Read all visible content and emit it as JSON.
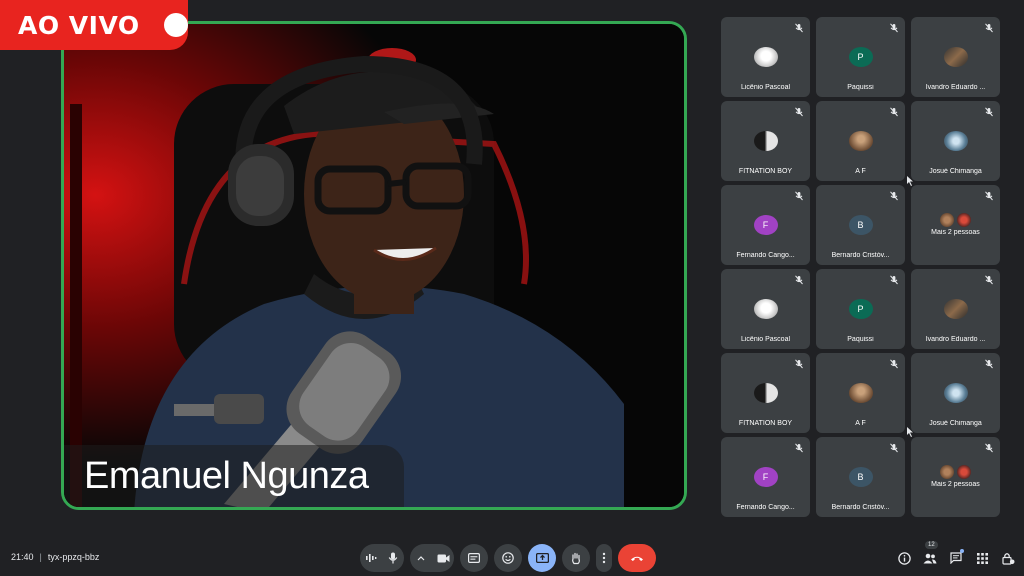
{
  "live_badge": {
    "label": "AO VIVO"
  },
  "main_speaker": {
    "name": "Emanuel Ngunza"
  },
  "participants": [
    {
      "name": "Licênio Pascoal",
      "avatar": "photo-white",
      "initial": ""
    },
    {
      "name": "Paquissi",
      "avatar": "letter-p",
      "initial": "P"
    },
    {
      "name": "Ivandro Eduardo ...",
      "avatar": "photo-dark",
      "initial": ""
    },
    {
      "name": "FITNATION BOY",
      "avatar": "photo-bw",
      "initial": ""
    },
    {
      "name": "A F",
      "avatar": "photo-brown",
      "initial": ""
    },
    {
      "name": "Josué Chimanga",
      "avatar": "photo-blue",
      "initial": ""
    },
    {
      "name": "Fernando Cango...",
      "avatar": "letter-f",
      "initial": "F"
    },
    {
      "name": "Bernardo Cristóv...",
      "avatar": "letter-b",
      "initial": "B"
    },
    {
      "name": "Mais 2 pessoas",
      "avatar": "pair",
      "initial": ""
    },
    {
      "name": "Licênio Pascoal",
      "avatar": "photo-white",
      "initial": ""
    },
    {
      "name": "Paquissi",
      "avatar": "letter-p",
      "initial": "P"
    },
    {
      "name": "Ivandro Eduardo ...",
      "avatar": "photo-dark",
      "initial": ""
    },
    {
      "name": "FITNATION BOY",
      "avatar": "photo-bw",
      "initial": ""
    },
    {
      "name": "A F",
      "avatar": "photo-brown",
      "initial": ""
    },
    {
      "name": "Josué Chimanga",
      "avatar": "photo-blue",
      "initial": ""
    },
    {
      "name": "Fernando Cango...",
      "avatar": "letter-f",
      "initial": "F"
    },
    {
      "name": "Bernardo Cristóv...",
      "avatar": "letter-b",
      "initial": "B"
    },
    {
      "name": "Mais 2 pessoas",
      "avatar": "pair",
      "initial": ""
    }
  ],
  "meeting": {
    "time": "21:40",
    "separator": "|",
    "code": "tyx-ppzq-bbz"
  },
  "people_count": "12",
  "colors": {
    "live_red": "#e8241f",
    "speaker_border": "#34a853",
    "end_call": "#ea4335",
    "active_button": "#8ab4f8"
  },
  "icons": {
    "toolbar": [
      "audio-levels-icon",
      "microphone-icon",
      "chevron-up-icon",
      "camera-icon",
      "captions-icon",
      "emoji-icon",
      "present-screen-icon",
      "raise-hand-icon",
      "more-options-icon",
      "end-call-icon"
    ],
    "right": [
      "info-icon",
      "people-icon",
      "chat-icon",
      "activities-icon",
      "host-controls-icon"
    ]
  }
}
